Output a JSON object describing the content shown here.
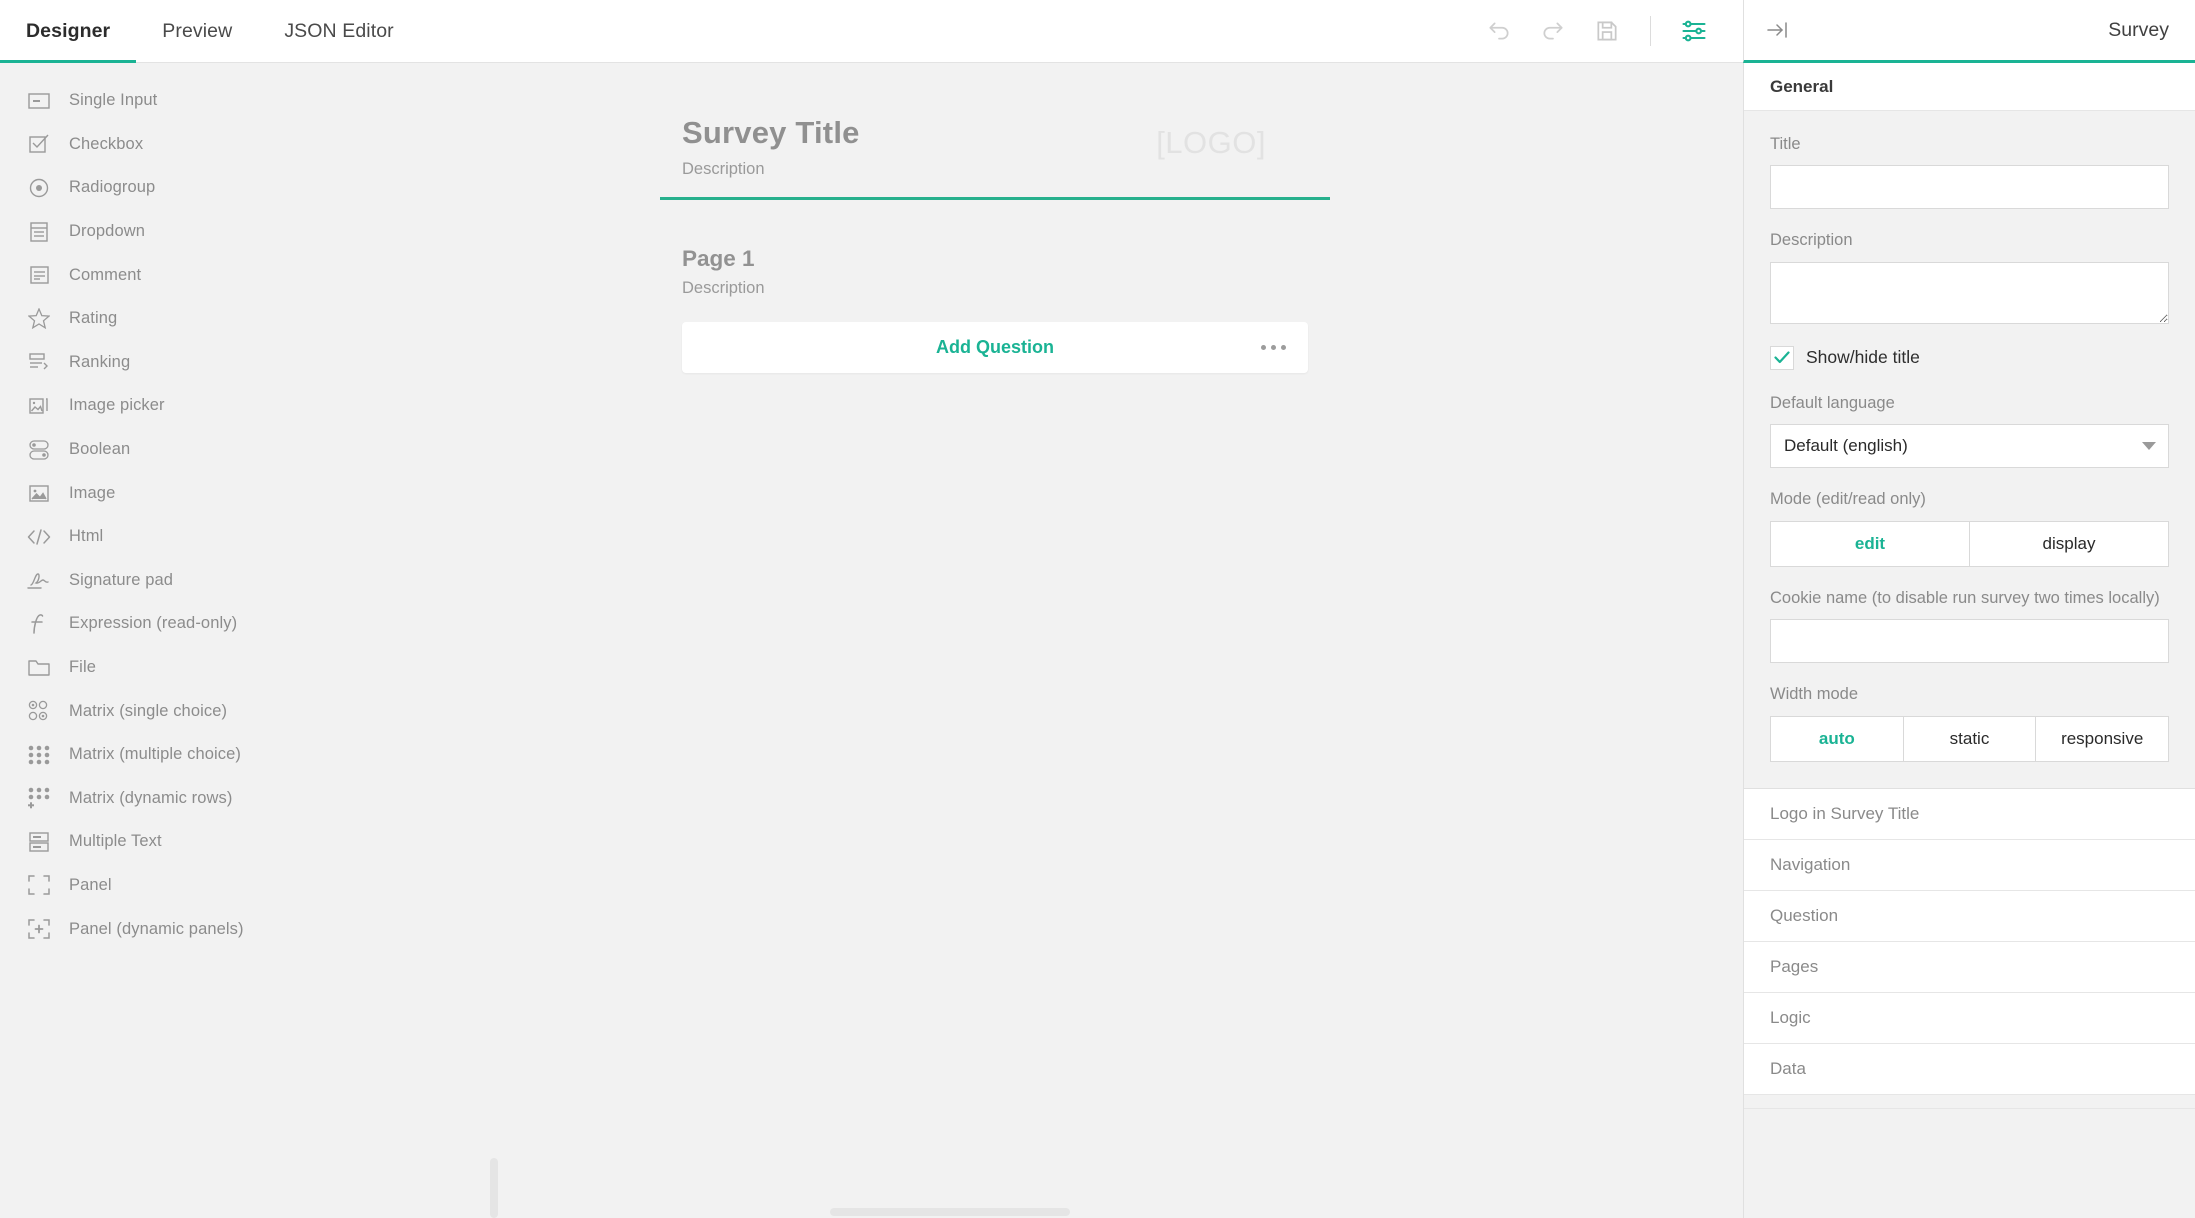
{
  "topbar": {
    "tabs": [
      {
        "label": "Designer",
        "active": true
      },
      {
        "label": "Preview",
        "active": false
      },
      {
        "label": "JSON Editor",
        "active": false
      }
    ],
    "actions": [
      {
        "name": "undo",
        "title": "Undo"
      },
      {
        "name": "redo",
        "title": "Redo"
      },
      {
        "name": "save",
        "title": "Save"
      },
      {
        "name": "settings",
        "title": "Settings"
      }
    ]
  },
  "toolbox": {
    "items": [
      {
        "label": "Single Input",
        "icon": "single-input-icon"
      },
      {
        "label": "Checkbox",
        "icon": "checkbox-icon"
      },
      {
        "label": "Radiogroup",
        "icon": "radiogroup-icon"
      },
      {
        "label": "Dropdown",
        "icon": "dropdown-icon"
      },
      {
        "label": "Comment",
        "icon": "comment-icon"
      },
      {
        "label": "Rating",
        "icon": "rating-star-icon"
      },
      {
        "label": "Ranking",
        "icon": "ranking-icon"
      },
      {
        "label": "Image picker",
        "icon": "image-picker-icon"
      },
      {
        "label": "Boolean",
        "icon": "boolean-toggle-icon"
      },
      {
        "label": "Image",
        "icon": "image-icon"
      },
      {
        "label": "Html",
        "icon": "html-code-icon"
      },
      {
        "label": "Signature pad",
        "icon": "signature-pad-icon"
      },
      {
        "label": "Expression (read-only)",
        "icon": "expression-function-icon"
      },
      {
        "label": "File",
        "icon": "file-folder-icon"
      },
      {
        "label": "Matrix (single choice)",
        "icon": "matrix-single-icon"
      },
      {
        "label": "Matrix (multiple choice)",
        "icon": "matrix-multiple-icon"
      },
      {
        "label": "Matrix (dynamic rows)",
        "icon": "matrix-dynamic-icon"
      },
      {
        "label": "Multiple Text",
        "icon": "multiple-text-icon"
      },
      {
        "label": "Panel",
        "icon": "panel-icon"
      },
      {
        "label": "Panel (dynamic panels)",
        "icon": "panel-dynamic-icon"
      }
    ]
  },
  "canvas": {
    "survey_title": "Survey Title",
    "survey_description": "Description",
    "logo_placeholder": "[LOGO]",
    "page_title": "Page 1",
    "page_description": "Description",
    "add_question_label": "Add Question"
  },
  "property_panel": {
    "header_title": "Survey",
    "collapse_icon": "collapse-right-icon",
    "general_header": "General",
    "title_label": "Title",
    "title_value": "",
    "description_label": "Description",
    "description_value": "",
    "showhide_title_label": "Show/hide title",
    "showhide_title_checked": true,
    "default_language_label": "Default language",
    "default_language_value": "Default (english)",
    "mode_label": "Mode (edit/read only)",
    "mode_options": [
      {
        "label": "edit",
        "active": true
      },
      {
        "label": "display",
        "active": false
      }
    ],
    "cookie_label": "Cookie name (to disable run survey two times locally)",
    "cookie_value": "",
    "width_mode_label": "Width mode",
    "width_mode_options": [
      {
        "label": "auto",
        "active": true
      },
      {
        "label": "static",
        "active": false
      },
      {
        "label": "responsive",
        "active": false
      }
    ],
    "sections": [
      {
        "label": "Logo in Survey Title"
      },
      {
        "label": "Navigation"
      },
      {
        "label": "Question"
      },
      {
        "label": "Pages"
      },
      {
        "label": "Logic"
      },
      {
        "label": "Data"
      }
    ]
  },
  "colors": {
    "accent": "#1ab394",
    "background": "#f2f2f2",
    "panel": "#ffffff",
    "muted_text": "#8a8a8a"
  }
}
